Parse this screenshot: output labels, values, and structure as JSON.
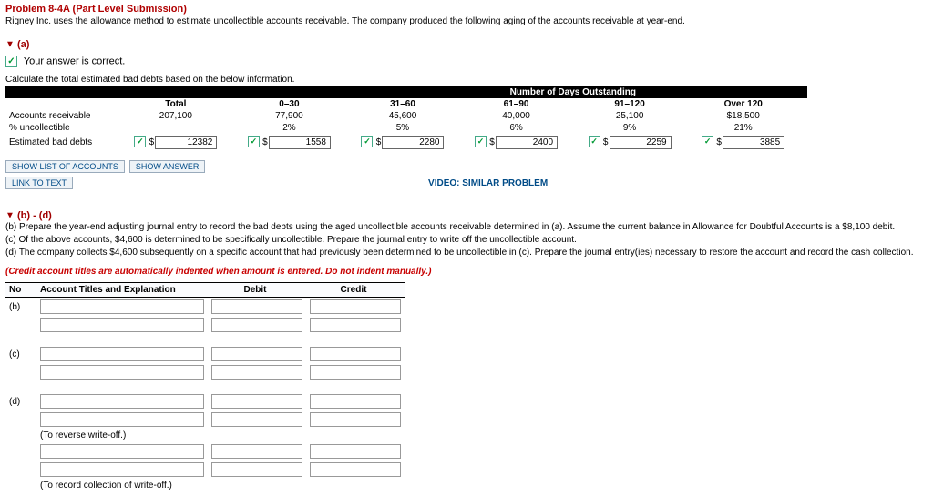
{
  "header": {
    "problem_title": "Problem 8-4A (Part Level Submission)",
    "intro": "Rigney Inc. uses the allowance method to estimate uncollectible accounts receivable. The company produced the following aging of the accounts receivable at year-end."
  },
  "part_a": {
    "toggle_glyph": "▼",
    "label": "(a)",
    "correct_check": "✓",
    "correct_text": "Your answer is correct.",
    "instruction": "Calculate the total estimated bad debts based on the below information.",
    "table_caption": "Number of Days Outstanding",
    "columns": {
      "total": "Total",
      "c0_30": "0–30",
      "c31_60": "31–60",
      "c61_90": "61–90",
      "c91_120": "91–120",
      "over_120": "Over 120"
    },
    "row_labels": {
      "ar": "Accounts receivable",
      "pct": "% uncollectible",
      "est": "Estimated bad debts"
    },
    "data": {
      "ar": {
        "total": "207,100",
        "c0_30": "77,900",
        "c31_60": "45,600",
        "c61_90": "40,000",
        "c91_120": "25,100",
        "over_120": "$18,500"
      },
      "pct": {
        "total": "",
        "c0_30": "2%",
        "c31_60": "5%",
        "c61_90": "6%",
        "c91_120": "9%",
        "over_120": "21%"
      },
      "est": {
        "total": "12382",
        "c0_30": "1558",
        "c31_60": "2280",
        "c61_90": "2400",
        "c91_120": "2259",
        "over_120": "3885"
      }
    },
    "buttons": {
      "show_list": "SHOW LIST OF ACCOUNTS",
      "show_answer": "SHOW ANSWER",
      "link_to_text": "LINK TO TEXT"
    },
    "video_link": "VIDEO: SIMILAR PROBLEM"
  },
  "part_bd": {
    "toggle_glyph": "▼",
    "label": "(b) - (d)",
    "lines": {
      "b": "(b)  Prepare the year-end adjusting journal entry to record the bad debts using the aged uncollectible accounts receivable determined in (a). Assume the current balance in Allowance for Doubtful Accounts is a $8,100 debit.",
      "c": "(c)  Of the above accounts, $4,600 is determined to be specifically uncollectible. Prepare the journal entry to write off the uncollectible account.",
      "d": "(d)  The company collects $4,600 subsequently on a specific account that had previously been determined to be uncollectible in (c). Prepare the journal entry(ies) necessary to restore the account and record the cash collection."
    },
    "note": "(Credit account titles are automatically indented when amount is entered. Do not indent manually.)",
    "headers": {
      "no": "No",
      "titles": "Account Titles and Explanation",
      "debit": "Debit",
      "credit": "Credit"
    },
    "row_labels": {
      "b": "(b)",
      "c": "(c)",
      "d": "(d)"
    },
    "captions": {
      "reverse": "(To reverse write-off.)",
      "record": "(To record collection of write-off.)"
    }
  }
}
